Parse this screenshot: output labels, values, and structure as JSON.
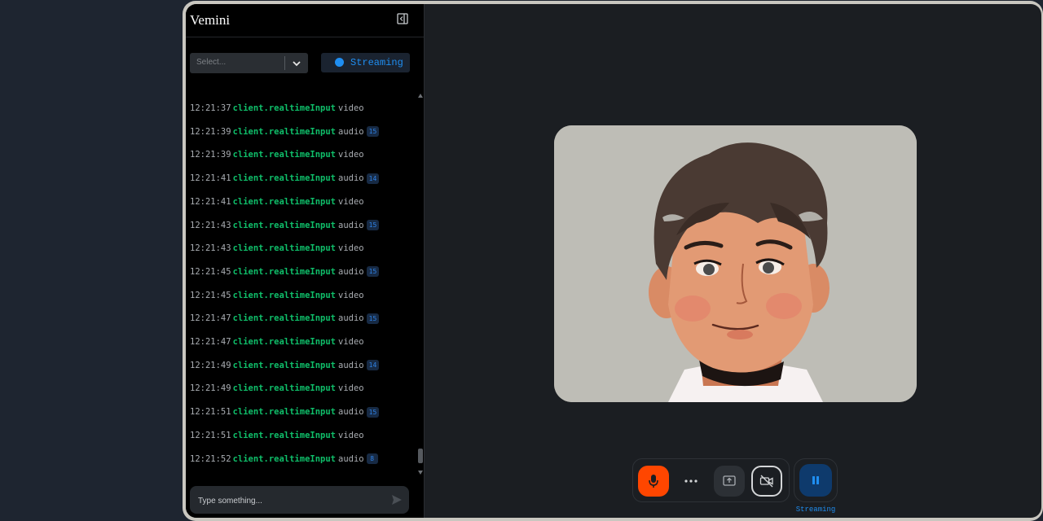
{
  "sidebar": {
    "title": "Vemini",
    "model_select": {
      "placeholder": "Select..."
    },
    "streaming_status": "Streaming",
    "composer": {
      "placeholder": "Type something..."
    }
  },
  "logs": [
    {
      "time": "12:21:37",
      "method": "client.realtimeInput",
      "type": "video",
      "count": ""
    },
    {
      "time": "12:21:39",
      "method": "client.realtimeInput",
      "type": "audio",
      "count": "15"
    },
    {
      "time": "12:21:39",
      "method": "client.realtimeInput",
      "type": "video",
      "count": ""
    },
    {
      "time": "12:21:41",
      "method": "client.realtimeInput",
      "type": "audio",
      "count": "14"
    },
    {
      "time": "12:21:41",
      "method": "client.realtimeInput",
      "type": "video",
      "count": ""
    },
    {
      "time": "12:21:43",
      "method": "client.realtimeInput",
      "type": "audio",
      "count": "15"
    },
    {
      "time": "12:21:43",
      "method": "client.realtimeInput",
      "type": "video",
      "count": ""
    },
    {
      "time": "12:21:45",
      "method": "client.realtimeInput",
      "type": "audio",
      "count": "15"
    },
    {
      "time": "12:21:45",
      "method": "client.realtimeInput",
      "type": "video",
      "count": ""
    },
    {
      "time": "12:21:47",
      "method": "client.realtimeInput",
      "type": "audio",
      "count": "15"
    },
    {
      "time": "12:21:47",
      "method": "client.realtimeInput",
      "type": "video",
      "count": ""
    },
    {
      "time": "12:21:49",
      "method": "client.realtimeInput",
      "type": "audio",
      "count": "14"
    },
    {
      "time": "12:21:49",
      "method": "client.realtimeInput",
      "type": "video",
      "count": ""
    },
    {
      "time": "12:21:51",
      "method": "client.realtimeInput",
      "type": "audio",
      "count": "15"
    },
    {
      "time": "12:21:51",
      "method": "client.realtimeInput",
      "type": "video",
      "count": ""
    },
    {
      "time": "12:21:52",
      "method": "client.realtimeInput",
      "type": "audio",
      "count": "8"
    }
  ],
  "controls": {
    "connect_label": "Streaming",
    "icons": [
      "mic-icon",
      "more-icon",
      "screen-share-icon",
      "camera-off-icon",
      "pause-icon"
    ]
  },
  "colors": {
    "accent": "#1f8ef1",
    "mic_active": "#ff4600",
    "log_method": "#0fbf6a"
  }
}
